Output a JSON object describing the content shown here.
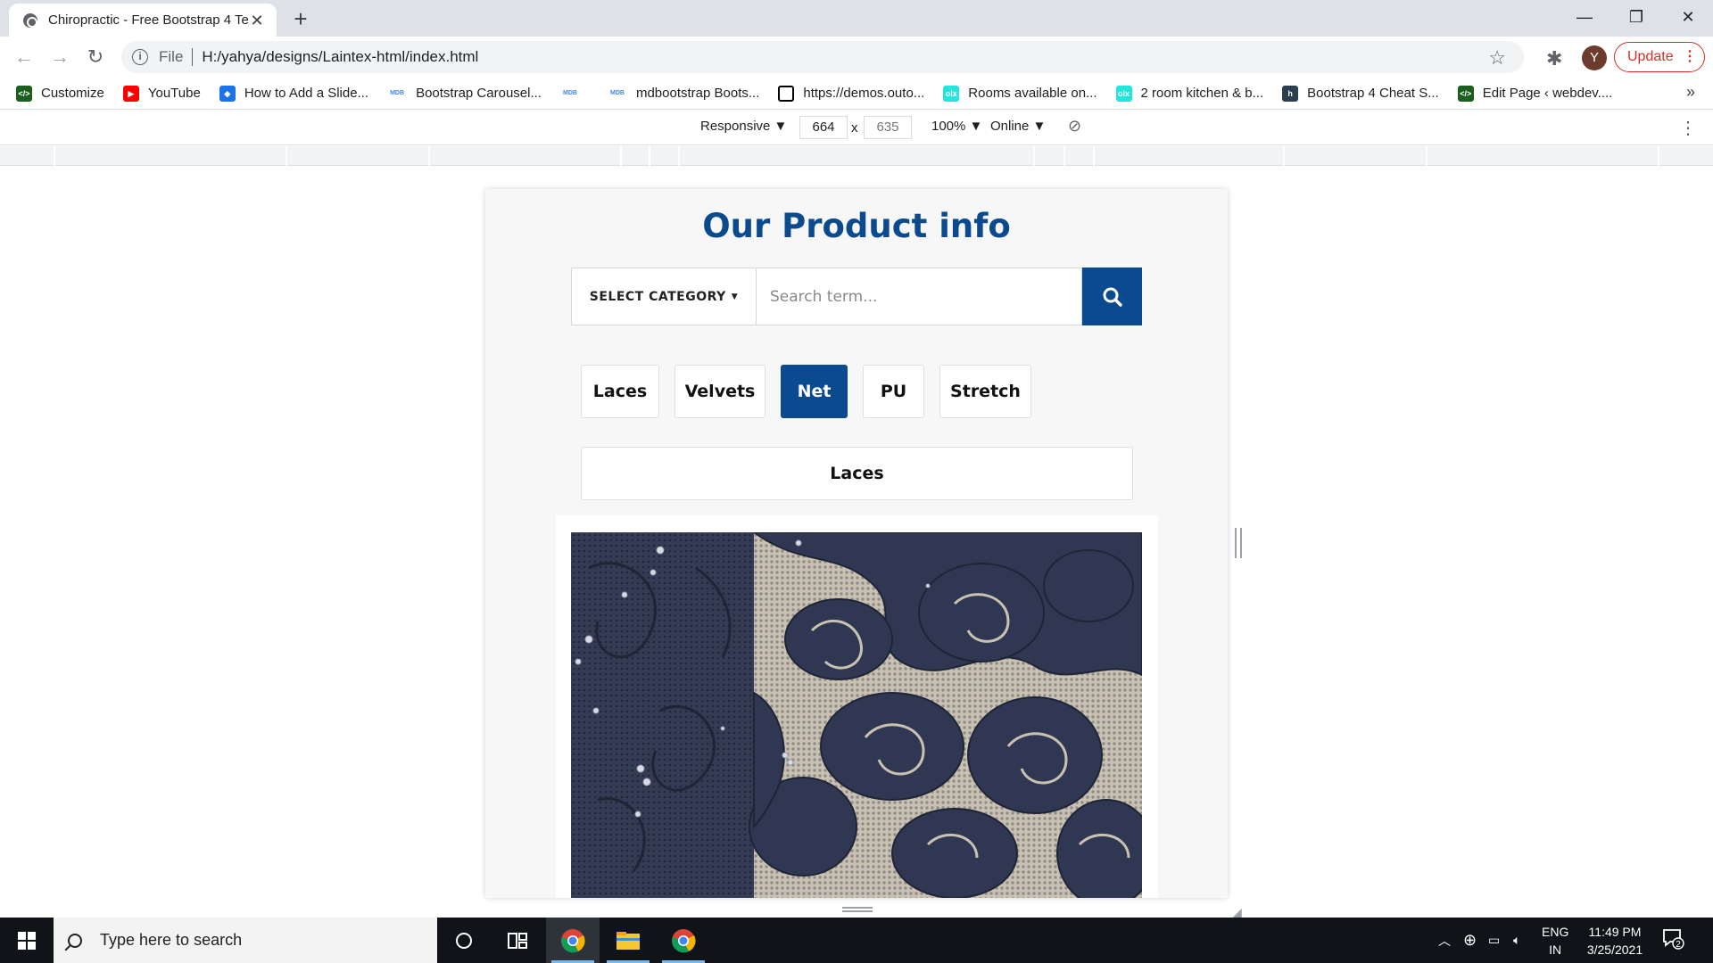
{
  "browser": {
    "tab_title": "Chiropractic - Free Bootstrap 4 Te",
    "new_tab": "+",
    "tab_close": "✕",
    "window": {
      "minimize": "—",
      "restore": "❐",
      "close": "✕"
    },
    "nav": {
      "back": "←",
      "forward": "→",
      "reload": "↻"
    },
    "address": {
      "scheme": "File",
      "url": "H:/yahya/designs/Laintex-html/index.html"
    },
    "profile_initial": "Y",
    "update_label": "Update",
    "bookmarks": [
      {
        "label": "Customize",
        "icon": "code-icon",
        "color": "#1b5e20"
      },
      {
        "label": "YouTube",
        "icon": "youtube-icon",
        "color": "#ff0000"
      },
      {
        "label": "How to Add a Slide...",
        "icon": "bookmark-icon",
        "color": "#1a73e8"
      },
      {
        "label": "Bootstrap Carousel...",
        "icon": "mdb-icon",
        "color": "#4285f4"
      },
      {
        "label": "",
        "icon": "mdb-icon",
        "color": "#4285f4"
      },
      {
        "label": "mdbootstrap Boots...",
        "icon": "mdb-icon",
        "color": "#4285f4"
      },
      {
        "label": "https://demos.outo...",
        "icon": "square-icon",
        "color": "#000000"
      },
      {
        "label": "Rooms available on...",
        "icon": "olx-icon",
        "color": "#23e5db"
      },
      {
        "label": "2 room kitchen & b...",
        "icon": "olx-icon",
        "color": "#23e5db"
      },
      {
        "label": "Bootstrap 4 Cheat S...",
        "icon": "h-icon",
        "color": "#2c3e50"
      },
      {
        "label": "Edit Page ‹ webdev....",
        "icon": "code-icon",
        "color": "#1b5e20"
      }
    ],
    "bookmarks_more": "»"
  },
  "devtools": {
    "device": "Responsive ▼",
    "width": "664",
    "times": "x",
    "height": "635",
    "zoom": "100% ▼",
    "network": "Online ▼"
  },
  "page": {
    "title": "Our Product info",
    "select_category": "SELECT CATEGORY",
    "search_placeholder": "Search term...",
    "categories": [
      {
        "label": "Laces",
        "active": false
      },
      {
        "label": "Velvets",
        "active": false
      },
      {
        "label": "Net",
        "active": true
      },
      {
        "label": "PU",
        "active": false
      },
      {
        "label": "Stretch",
        "active": false
      }
    ],
    "subheading": "Laces",
    "accent_color": "#0b4a8f"
  },
  "taskbar": {
    "search_placeholder": "Type here to search",
    "lang_line1": "ENG",
    "lang_line2": "IN",
    "time": "11:49 PM",
    "date": "3/25/2021",
    "notifications": "2"
  }
}
